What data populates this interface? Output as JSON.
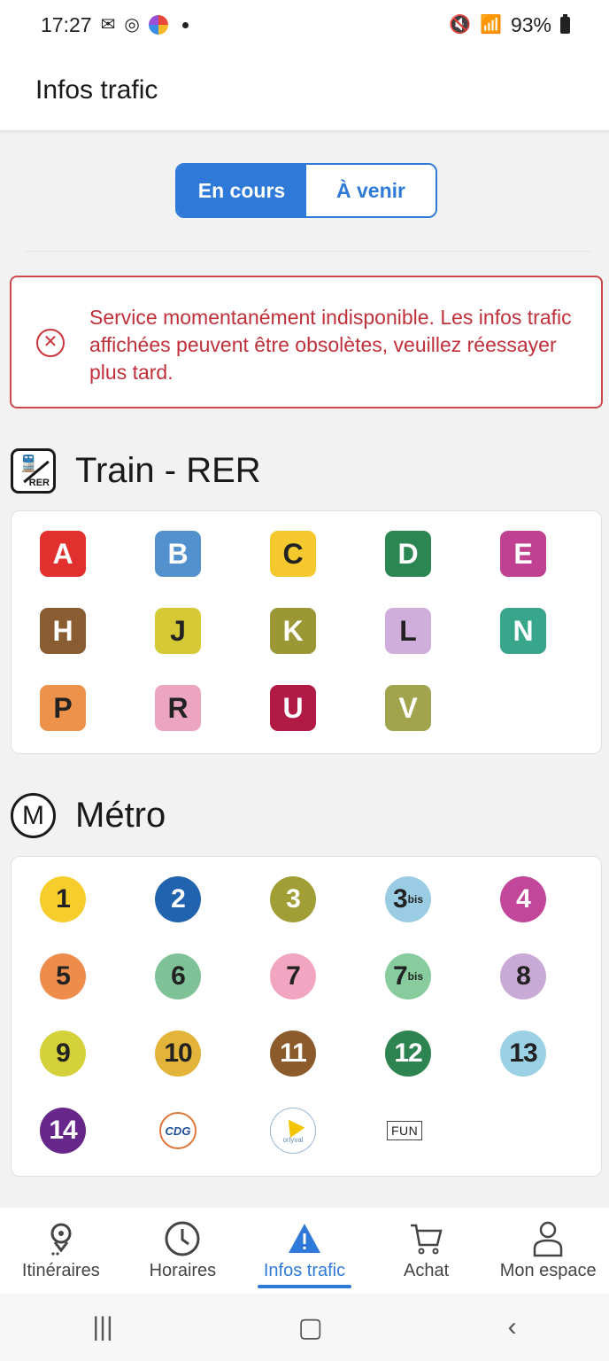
{
  "status_bar": {
    "time": "17:27",
    "battery": "93%"
  },
  "header": {
    "title": "Infos trafic"
  },
  "tabs": [
    {
      "label": "En cours",
      "active": true
    },
    {
      "label": "À venir",
      "active": false
    }
  ],
  "alert": {
    "message": "Service momentanément indisponible. Les infos trafic affichées peuvent être obsolètes, veuillez réessayer plus tard.",
    "color": "#c0303a"
  },
  "rer_section": {
    "title": "Train - RER",
    "icon_label": "RER",
    "lines": [
      {
        "label": "A",
        "color": "#e2302f",
        "text_dark": false
      },
      {
        "label": "B",
        "color": "#5291ce",
        "text_dark": false
      },
      {
        "label": "C",
        "color": "#f5c82d",
        "text_dark": true
      },
      {
        "label": "D",
        "color": "#2c8652",
        "text_dark": false
      },
      {
        "label": "E",
        "color": "#c04192",
        "text_dark": false
      },
      {
        "label": "H",
        "color": "#8a5c32",
        "text_dark": false
      },
      {
        "label": "J",
        "color": "#d5c936",
        "text_dark": true
      },
      {
        "label": "K",
        "color": "#9b9734",
        "text_dark": false
      },
      {
        "label": "L",
        "color": "#cfaedb",
        "text_dark": true
      },
      {
        "label": "N",
        "color": "#37a68a",
        "text_dark": false
      },
      {
        "label": "P",
        "color": "#ed924a",
        "text_dark": true
      },
      {
        "label": "R",
        "color": "#eba5c0",
        "text_dark": true
      },
      {
        "label": "U",
        "color": "#b11a44",
        "text_dark": false
      },
      {
        "label": "V",
        "color": "#a1a34d",
        "text_dark": false
      }
    ]
  },
  "metro_section": {
    "title": "Métro",
    "icon_label": "M",
    "lines": [
      {
        "label": "1",
        "bis": "",
        "color": "#f7cd2c",
        "text_dark": true
      },
      {
        "label": "2",
        "bis": "",
        "color": "#2163ae",
        "text_dark": false
      },
      {
        "label": "3",
        "bis": "",
        "color": "#a19e35",
        "text_dark": false
      },
      {
        "label": "3",
        "bis": "bis",
        "color": "#9acce3",
        "text_dark": true
      },
      {
        "label": "4",
        "bis": "",
        "color": "#c2479a",
        "text_dark": false
      },
      {
        "label": "5",
        "bis": "",
        "color": "#ee8c4b",
        "text_dark": true
      },
      {
        "label": "6",
        "bis": "",
        "color": "#7fc297",
        "text_dark": true
      },
      {
        "label": "7",
        "bis": "",
        "color": "#f2a5c1",
        "text_dark": true
      },
      {
        "label": "7",
        "bis": "bis",
        "color": "#88cc9d",
        "text_dark": true
      },
      {
        "label": "8",
        "bis": "",
        "color": "#c9a9d5",
        "text_dark": true
      },
      {
        "label": "9",
        "bis": "",
        "color": "#d4d13a",
        "text_dark": true
      },
      {
        "label": "10",
        "bis": "",
        "color": "#e3b43a",
        "text_dark": true
      },
      {
        "label": "11",
        "bis": "",
        "color": "#8c5b2b",
        "text_dark": false
      },
      {
        "label": "12",
        "bis": "",
        "color": "#2d8450",
        "text_dark": false
      },
      {
        "label": "13",
        "bis": "",
        "color": "#9bd1e4",
        "text_dark": true
      },
      {
        "label": "14",
        "bis": "",
        "color": "#66268a",
        "text_dark": false
      }
    ],
    "special": {
      "cdg": "CDG",
      "orly": "orlyval",
      "fun": "FUN"
    }
  },
  "bottom_nav": [
    {
      "label": "Itinéraires",
      "icon": "map-pin-icon",
      "active": false
    },
    {
      "label": "Horaires",
      "icon": "clock-icon",
      "active": false
    },
    {
      "label": "Infos trafic",
      "icon": "warning-icon",
      "active": true
    },
    {
      "label": "Achat",
      "icon": "cart-icon",
      "active": false
    },
    {
      "label": "Mon espace",
      "icon": "user-icon",
      "active": false
    }
  ],
  "accent_color": "#2f7ad9"
}
